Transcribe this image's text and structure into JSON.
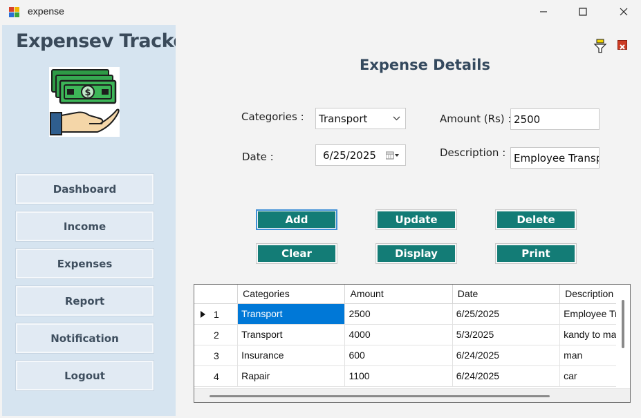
{
  "window": {
    "title": "expense",
    "buttons": {
      "minimize": "minimize-icon",
      "maximize": "maximize-icon",
      "close": "close-icon"
    }
  },
  "sidebar": {
    "app_title": "Expensev Tracker",
    "logo_icon": "money-hand-icon",
    "items": [
      {
        "label": "Dashboard"
      },
      {
        "label": "Income"
      },
      {
        "label": "Expenses"
      },
      {
        "label": "Report"
      },
      {
        "label": "Notification"
      },
      {
        "label": "Logout"
      }
    ]
  },
  "main": {
    "heading": "Expense Details",
    "top_icons": {
      "filter": "filter-icon",
      "close": "close-x-icon"
    },
    "form": {
      "categories_label": "Categories :",
      "categories_value": "Transport",
      "amount_label": "Amount (Rs) :",
      "amount_value": "2500",
      "date_label": "Date :",
      "date_value": "6/25/2025",
      "description_label": "Description :",
      "description_value": "Employee Transpo"
    },
    "actions": {
      "add": "Add",
      "update": "Update",
      "delete": "Delete",
      "clear": "Clear",
      "display": "Display",
      "print": "Print"
    },
    "grid": {
      "columns": [
        "Categories",
        "Amount",
        "Date",
        "Description"
      ],
      "rows": [
        {
          "num": "1",
          "category": "Transport",
          "amount": "2500",
          "date": "6/25/2025",
          "description": "Employee Tr"
        },
        {
          "num": "2",
          "category": "Transport",
          "amount": "4000",
          "date": "5/3/2025",
          "description": "kandy to ma"
        },
        {
          "num": "3",
          "category": "Insurance",
          "amount": "600",
          "date": "6/24/2025",
          "description": "man"
        },
        {
          "num": "4",
          "category": "Rapair",
          "amount": "1100",
          "date": "6/24/2025",
          "description": "car"
        }
      ]
    }
  },
  "colors": {
    "sidebar_bg": "#d6e4f0",
    "accent": "#137c76",
    "selection": "#0078d7",
    "heading": "#34495e"
  }
}
